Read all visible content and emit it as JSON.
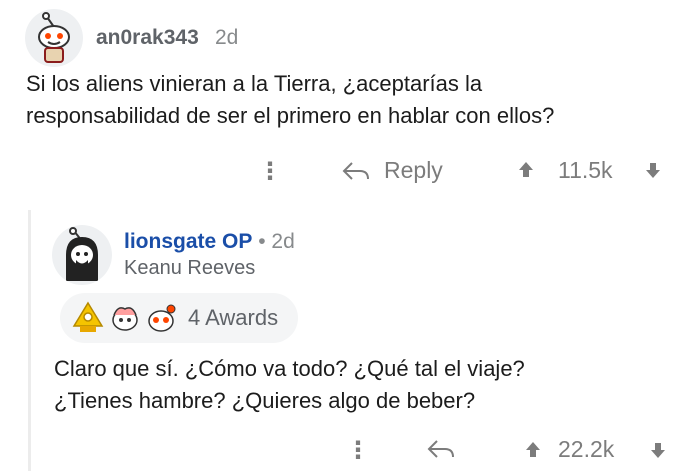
{
  "comments": [
    {
      "username": "an0rak343",
      "age": "2d",
      "text_lines": [
        "Si los aliens vinieran a la Tierra, ¿aceptarías la",
        "responsabilidad de ser el primero en hablar con ellos?"
      ],
      "actions": {
        "more": "⋮",
        "reply": "Reply",
        "score": "11.5k"
      }
    },
    {
      "username": "lionsgate",
      "op_badge": "OP",
      "separator": "•",
      "age": "2d",
      "flair": "Keanu Reeves",
      "awards_label": "4 Awards",
      "text_lines": [
        "Claro que sí. ¿Cómo va todo? ¿Qué tal el viaje?",
        "¿Tienes hambre? ¿Quieres algo de beber?"
      ],
      "actions": {
        "more": "⋮",
        "score": "22.2k"
      }
    }
  ],
  "icons": [
    "snoo-avatar-icon",
    "reply-arrow-icon",
    "upvote-icon",
    "downvote-icon",
    "more-options-icon",
    "award-icon"
  ],
  "colors": {
    "op": "#1a4ea8",
    "muted": "#878a8c",
    "text": "#1c1c1c"
  }
}
